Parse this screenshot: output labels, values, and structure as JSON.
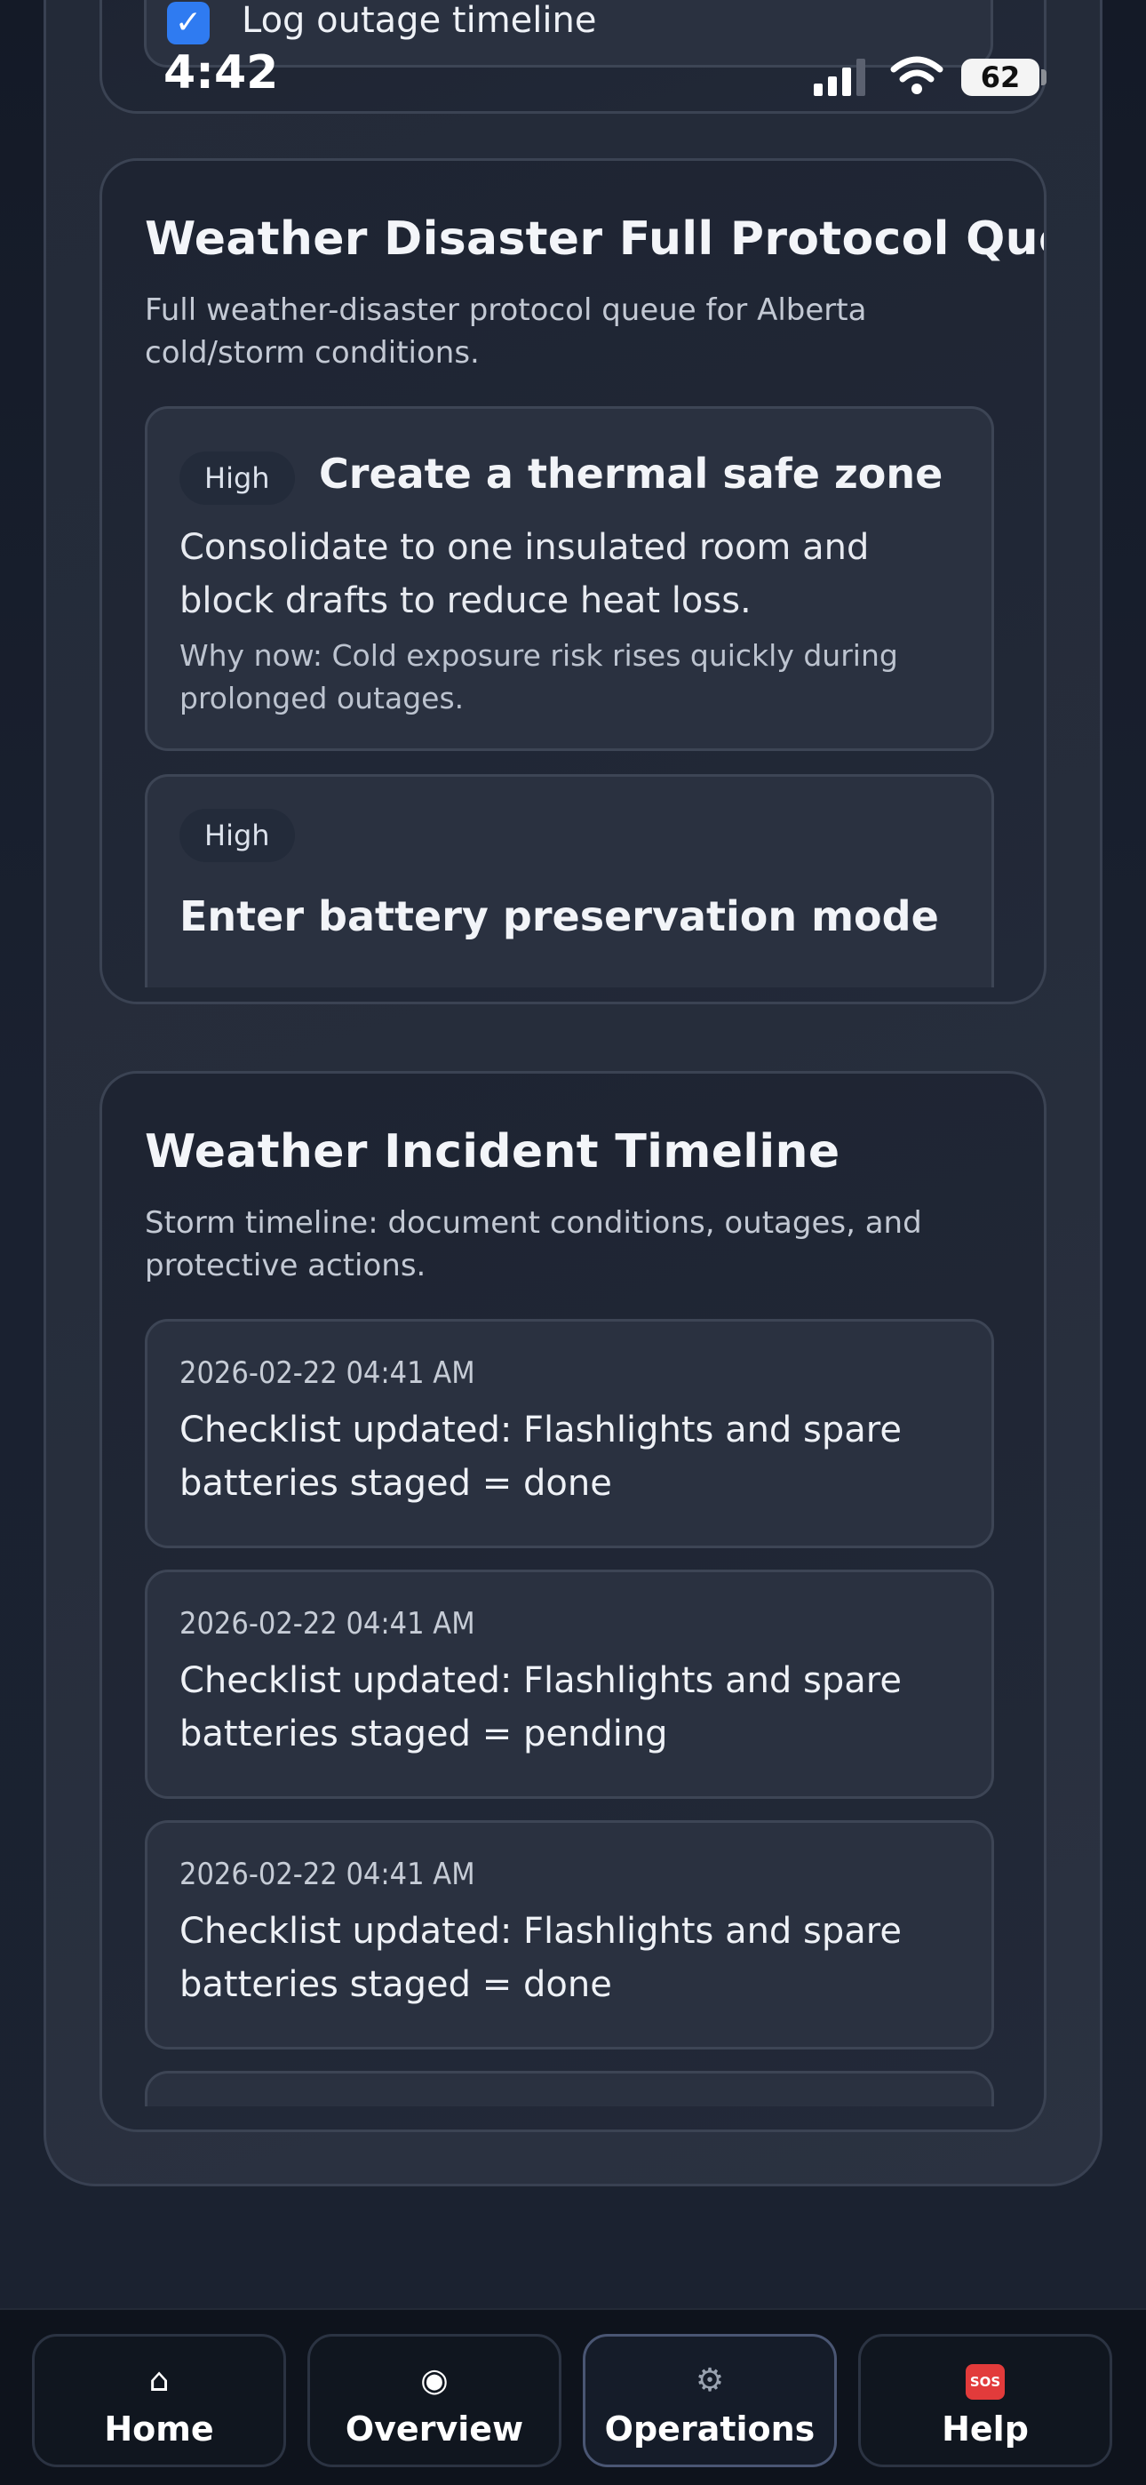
{
  "status_bar": {
    "time": "4:42",
    "battery": "62"
  },
  "top_checklist": {
    "item_label": "Log outage timeline",
    "checked": true
  },
  "protocol_card": {
    "title": "Weather Disaster Full Protocol Queue",
    "subtitle": "Full weather-disaster protocol queue for Alberta cold/storm conditions.",
    "items": [
      {
        "badge": "High",
        "title": "Create a thermal safe zone",
        "description": "Consolidate to one insulated room and block drafts to reduce heat loss.",
        "why": "Why now: Cold exposure risk rises quickly during prolonged outages."
      },
      {
        "badge": "High",
        "title": "Enter battery preservation mode"
      }
    ]
  },
  "timeline_card": {
    "title": "Weather Incident Timeline",
    "subtitle": "Storm timeline: document conditions, outages, and protective actions.",
    "entries": [
      {
        "timestamp": "2026-02-22 04:41 AM",
        "text": "Checklist updated: Flashlights and spare batteries staged = done"
      },
      {
        "timestamp": "2026-02-22 04:41 AM",
        "text": "Checklist updated: Flashlights and spare batteries staged = pending"
      },
      {
        "timestamp": "2026-02-22 04:41 AM",
        "text": "Checklist updated: Flashlights and spare batteries staged = done"
      }
    ]
  },
  "nav": {
    "items": [
      {
        "label": "Home",
        "icon": "home-icon"
      },
      {
        "label": "Overview",
        "icon": "radio-dot-icon"
      },
      {
        "label": "Operations",
        "icon": "gear-icon",
        "active": true
      },
      {
        "label": "Help",
        "icon": "sos-icon",
        "icon_text": "SOS"
      }
    ]
  }
}
